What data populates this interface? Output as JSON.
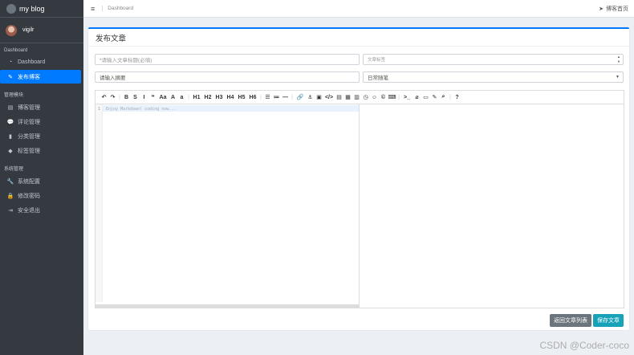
{
  "brand": {
    "title": "my blog"
  },
  "user": {
    "name": "vigilr"
  },
  "sidebar": {
    "sections": [
      {
        "heading": "Dashboard",
        "items": [
          {
            "label": "Dashboard",
            "icon": "dashboard-icon"
          },
          {
            "label": "发布博客",
            "icon": "edit-icon",
            "active": true
          }
        ]
      },
      {
        "heading": "管理模块",
        "items": [
          {
            "label": "博客管理",
            "icon": "list-icon"
          },
          {
            "label": "评论管理",
            "icon": "comment-icon"
          },
          {
            "label": "分类管理",
            "icon": "bookmark-icon"
          },
          {
            "label": "标签管理",
            "icon": "tag-icon"
          }
        ]
      },
      {
        "heading": "系统管理",
        "items": [
          {
            "label": "系统配置",
            "icon": "wrench-icon"
          },
          {
            "label": "修改密码",
            "icon": "lock-icon"
          },
          {
            "label": "安全退出",
            "icon": "logout-icon"
          }
        ]
      }
    ]
  },
  "topbar": {
    "breadcrumb": "Dashboard",
    "home_link": "博客首页"
  },
  "card": {
    "title": "发布文章"
  },
  "form": {
    "title_placeholder": "*请输入文章标题(必填)",
    "tag_placeholder": "文章标签",
    "summary_placeholder": "请输入摘要",
    "category_value": "日常随笔"
  },
  "editor": {
    "line_number": "1",
    "placeholder": "Enjoy Markdown! coding now...",
    "toolbar": [
      "↶",
      "↷",
      "|",
      "B",
      "S",
      "I",
      "❝",
      "Aa",
      "A",
      "a",
      "|",
      "H1",
      "H2",
      "H3",
      "H4",
      "H5",
      "H6",
      "|",
      "☰",
      "≔",
      "—",
      "|",
      "🔗",
      "⚓",
      "▣",
      "</>",
      "▤",
      "▦",
      "▥",
      "◷",
      "☺",
      "©",
      "⌨",
      "|",
      ">_",
      "⌀",
      "▭",
      "✎",
      "⌕",
      "|",
      "?"
    ]
  },
  "buttons": {
    "back": "返回文章列表",
    "save": "保存文章"
  },
  "watermark": "CSDN @Coder-coco",
  "colors": {
    "primary": "#007bff",
    "sidebar": "#343a40",
    "info": "#17a2b8",
    "secondary": "#6c757d"
  }
}
